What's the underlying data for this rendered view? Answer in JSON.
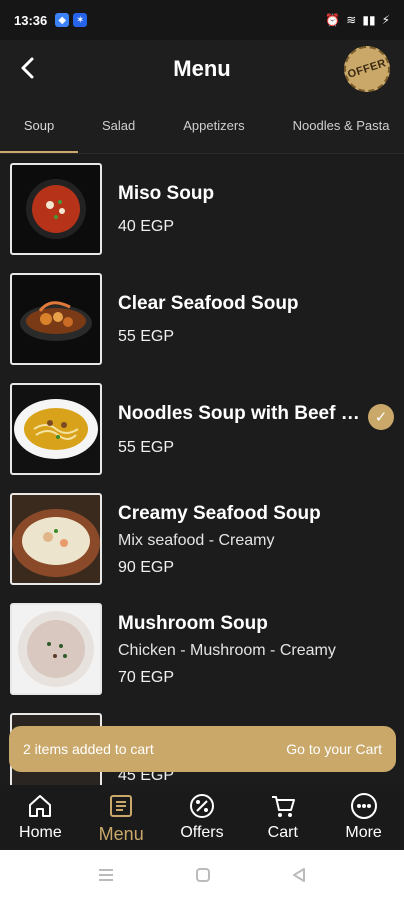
{
  "status_bar": {
    "time": "13:36"
  },
  "header": {
    "title": "Menu",
    "offer_badge": "OFFER"
  },
  "tabs": [
    {
      "label": "Soup",
      "active": true
    },
    {
      "label": "Salad",
      "active": false
    },
    {
      "label": "Appetizers",
      "active": false
    },
    {
      "label": "Noodles & Pasta",
      "active": false
    }
  ],
  "items": [
    {
      "name": "Miso Soup",
      "desc": "",
      "price": "40 EGP",
      "checked": false
    },
    {
      "name": "Clear Seafood Soup",
      "desc": "",
      "price": "55 EGP",
      "checked": false
    },
    {
      "name": "Noodles Soup with Beef o...",
      "desc": "",
      "price": "55 EGP",
      "checked": true
    },
    {
      "name": "Creamy Seafood Soup",
      "desc": "Mix seafood - Creamy",
      "price": "90 EGP",
      "checked": false
    },
    {
      "name": "Mushroom Soup",
      "desc": "Chicken - Mushroom - Creamy",
      "price": "70 EGP",
      "checked": false
    },
    {
      "name": "",
      "desc": "",
      "price": "45 EGP",
      "checked": false
    }
  ],
  "cart_toast": {
    "message": "2 items added to cart",
    "action": "Go to your Cart"
  },
  "bottom_nav": [
    {
      "label": "Home",
      "icon": "home-icon",
      "active": false
    },
    {
      "label": "Menu",
      "icon": "menu-book-icon",
      "active": true
    },
    {
      "label": "Offers",
      "icon": "offers-tag-icon",
      "active": false
    },
    {
      "label": "Cart",
      "icon": "cart-icon",
      "active": false
    },
    {
      "label": "More",
      "icon": "more-icon",
      "active": false
    }
  ],
  "colors": {
    "accent": "#c9a86a",
    "background": "#1c1c1c"
  }
}
